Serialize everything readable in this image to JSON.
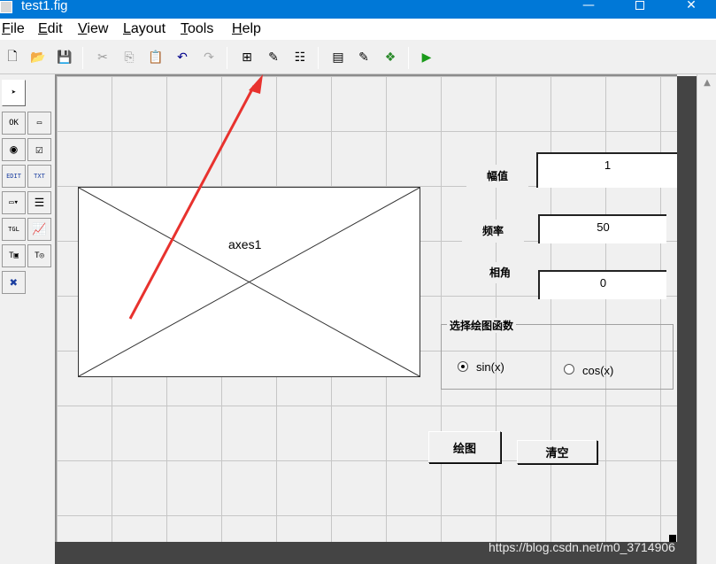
{
  "window": {
    "title": "test1.fig",
    "minimize": "—",
    "close": "✕"
  },
  "menu": [
    {
      "label": "File",
      "key": "F",
      "rest": "ile"
    },
    {
      "label": "Edit",
      "key": "E",
      "rest": "dit"
    },
    {
      "label": "View",
      "key": "V",
      "rest": "iew"
    },
    {
      "label": "Layout",
      "key": "L",
      "rest": "ayout"
    },
    {
      "label": "Tools",
      "key": "T",
      "rest": "ools"
    },
    {
      "label": "Help",
      "key": "H",
      "rest": "elp"
    }
  ],
  "toolbar": {
    "new": "🗋",
    "open": "📂",
    "save": "💾",
    "cut": "✂",
    "copy": "⎘",
    "paste": "📋",
    "undo": "↶",
    "redo": "↷",
    "align": "⊞",
    "menu_editor": "✎",
    "tab_order": "☷",
    "mfile_editor": "▤",
    "property_inspector": "✎",
    "object_browser": "❖",
    "run": "▶"
  },
  "palette": [
    {
      "name": "select-tool",
      "glyph": "➤"
    },
    {
      "name": "push-button-tool",
      "glyph": "OK"
    },
    {
      "name": "slider-tool",
      "glyph": "▭"
    },
    {
      "name": "radio-button-tool",
      "glyph": "◉"
    },
    {
      "name": "checkbox-tool",
      "glyph": "☑"
    },
    {
      "name": "edit-text-tool",
      "glyph": "EDIT"
    },
    {
      "name": "static-text-tool",
      "glyph": "TXT"
    },
    {
      "name": "popup-menu-tool",
      "glyph": "▭▾"
    },
    {
      "name": "listbox-tool",
      "glyph": "☰"
    },
    {
      "name": "toggle-button-tool",
      "glyph": "TGL"
    },
    {
      "name": "axes-tool",
      "glyph": "📈"
    },
    {
      "name": "panel-tool",
      "glyph": "T▣"
    },
    {
      "name": "button-group-tool",
      "glyph": "T◎"
    },
    {
      "name": "activex-tool",
      "glyph": "✖"
    }
  ],
  "axes": {
    "label": "axes1"
  },
  "labels": {
    "amplitude": "幅值",
    "frequency": "频率",
    "phase": "相角"
  },
  "edits": {
    "amplitude": "1",
    "frequency": "50",
    "phase": "0"
  },
  "group": {
    "title": "选择绘图函数",
    "options": [
      {
        "label": "sin(x)",
        "selected": true
      },
      {
        "label": "cos(x)",
        "selected": false
      }
    ]
  },
  "buttons": {
    "plot": "绘图",
    "clear": "清空"
  },
  "watermark": "https://blog.csdn.net/m0_3714906",
  "colors": {
    "titlebar": "#0078d7",
    "annotation_arrow": "#e8322e"
  }
}
